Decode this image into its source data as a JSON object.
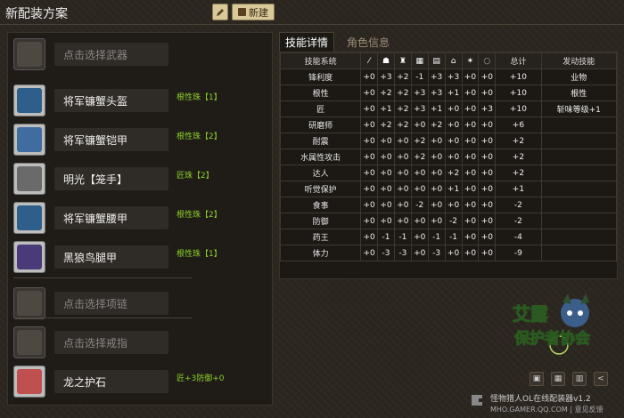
{
  "app": {
    "title": "新配装方案",
    "new_label": "新建"
  },
  "slots": [
    {
      "label": "点击选择武器",
      "tag": "",
      "placeholder": true,
      "color": "#4e4842"
    },
    {
      "label": "将军镰蟹头盔",
      "tag": "根性珠【1】",
      "placeholder": false,
      "color": "#2e5f8a"
    },
    {
      "label": "将军镰蟹铠甲",
      "tag": "根性珠【2】",
      "placeholder": false,
      "color": "#3f6da0"
    },
    {
      "label": "明光【笼手】",
      "tag": "匠珠【2】",
      "placeholder": false,
      "color": "#6a6a6a"
    },
    {
      "label": "将军镰蟹腰甲",
      "tag": "根性珠【2】",
      "placeholder": false,
      "color": "#2e5f8a"
    },
    {
      "label": "黑狼鸟腿甲",
      "tag": "根性珠【1】",
      "placeholder": false,
      "color": "#4a3a7a"
    },
    {
      "label": "点击选择项链",
      "tag": "",
      "placeholder": true,
      "color": "#4e4842"
    },
    {
      "label": "点击选择戒指",
      "tag": "",
      "placeholder": true,
      "color": "#4e4842"
    },
    {
      "label": "龙之护石",
      "tag": "匠+3防御+0",
      "placeholder": false,
      "color": "#c05050"
    }
  ],
  "tabs": {
    "active": "技能详情",
    "inactive": "角色信息"
  },
  "table": {
    "headers": {
      "name": "技能系统",
      "total": "总计",
      "activated": "发动技能"
    },
    "part_icons": [
      "sword-icon",
      "helmet-icon",
      "chest-icon",
      "gauntlet-icon",
      "waist-icon",
      "leg-icon",
      "necklace-icon",
      "ring-icon",
      "charm-icon"
    ],
    "part_glyphs": [
      "⁄",
      "☗",
      "♜",
      "▦",
      "▤",
      "⌂",
      "✶",
      "◌",
      "❍"
    ],
    "rows": [
      {
        "name": "锋利度",
        "vals": [
          "+0",
          "+3",
          "+2",
          "-1",
          "+3",
          "+3",
          "+0",
          "+0"
        ],
        "total": "+10",
        "act": "业物"
      },
      {
        "name": "根性",
        "vals": [
          "+0",
          "+2",
          "+2",
          "+3",
          "+3",
          "+1",
          "+0",
          "+0"
        ],
        "total": "+10",
        "act": "根性"
      },
      {
        "name": "匠",
        "vals": [
          "+0",
          "+1",
          "+2",
          "+3",
          "+1",
          "+0",
          "+0",
          "+3"
        ],
        "total": "+10",
        "act": "斩味等级+1"
      },
      {
        "name": "研磨师",
        "vals": [
          "+0",
          "+2",
          "+2",
          "+0",
          "+2",
          "+0",
          "+0",
          "+0"
        ],
        "total": "+6",
        "act": ""
      },
      {
        "name": "耐震",
        "vals": [
          "+0",
          "+0",
          "+0",
          "+2",
          "+0",
          "+0",
          "+0",
          "+0"
        ],
        "total": "+2",
        "act": ""
      },
      {
        "name": "水属性攻击",
        "vals": [
          "+0",
          "+0",
          "+0",
          "+2",
          "+0",
          "+0",
          "+0",
          "+0"
        ],
        "total": "+2",
        "act": ""
      },
      {
        "name": "达人",
        "vals": [
          "+0",
          "+0",
          "+0",
          "+0",
          "+0",
          "+2",
          "+0",
          "+0"
        ],
        "total": "+2",
        "act": ""
      },
      {
        "name": "听觉保护",
        "vals": [
          "+0",
          "+0",
          "+0",
          "+0",
          "+0",
          "+1",
          "+0",
          "+0"
        ],
        "total": "+1",
        "act": ""
      },
      {
        "name": "食事",
        "vals": [
          "+0",
          "+0",
          "+0",
          "-2",
          "+0",
          "+0",
          "+0",
          "+0"
        ],
        "total": "-2",
        "act": ""
      },
      {
        "name": "防御",
        "vals": [
          "+0",
          "+0",
          "+0",
          "+0",
          "+0",
          "-2",
          "+0",
          "+0"
        ],
        "total": "-2",
        "act": ""
      },
      {
        "name": "药王",
        "vals": [
          "+0",
          "-1",
          "-1",
          "+0",
          "-1",
          "-1",
          "+0",
          "+0"
        ],
        "total": "-4",
        "act": ""
      },
      {
        "name": "体力",
        "vals": [
          "+0",
          "-3",
          "-3",
          "+0",
          "-3",
          "+0",
          "+0",
          "+0"
        ],
        "total": "-9",
        "act": ""
      }
    ]
  },
  "logo": {
    "line1": "艾露",
    "line2": "保护者协会"
  },
  "footer": {
    "line1": "怪物猎人OL在线配装器v1.2",
    "line2": "MHO.GAMER.QQ.COM | 意见反馈"
  },
  "colors": {
    "tag_green": "#8bd12a",
    "accent_button": "#d8c89a",
    "panel_bg": "#1f1b17"
  }
}
